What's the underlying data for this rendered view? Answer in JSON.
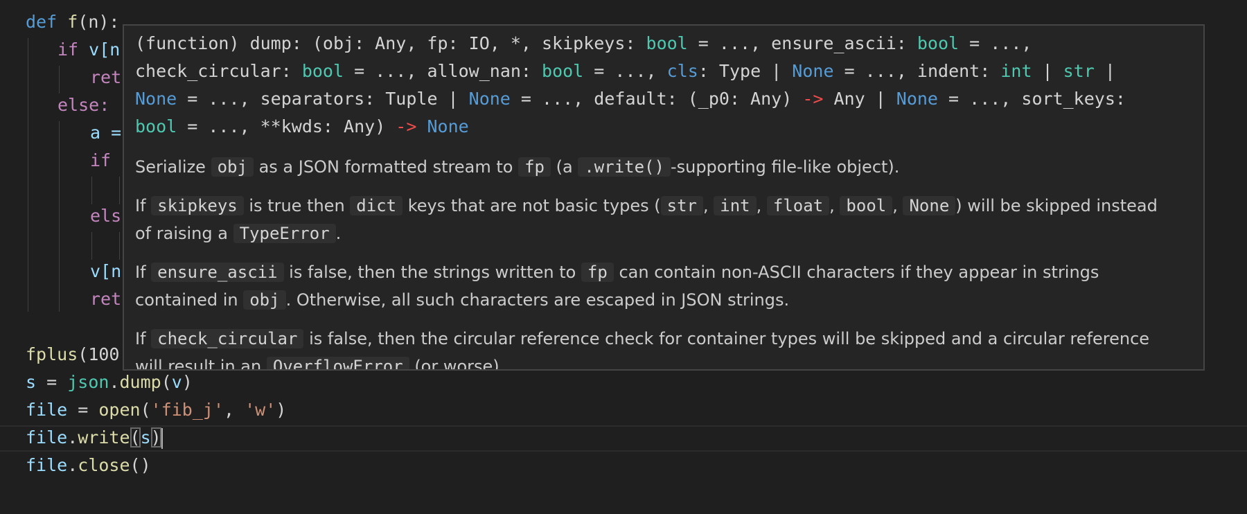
{
  "editor": {
    "lines": {
      "l1": {
        "kw": "def",
        "name": "f",
        "rest": "(n):"
      },
      "l2": {
        "kw": "if",
        "rest": " v[n"
      },
      "l3": {
        "text": "ret"
      },
      "l4": {
        "text": "else:"
      },
      "l5": {
        "text": "a ="
      },
      "l6": {
        "text": "if"
      },
      "l7": {
        "text": "els"
      },
      "l8": {
        "text": "v[n"
      },
      "l9": {
        "text": "ret"
      },
      "l10": {
        "name": "fplus",
        "rest": "(100"
      },
      "l11": {
        "var": "s",
        "eq": " = ",
        "mod": "json",
        "dot": ".",
        "fn": "dump",
        "open": "(",
        "arg": "v",
        "close": ")"
      },
      "l12": {
        "var": "file",
        "eq": " = ",
        "fn": "open",
        "open": "(",
        "s1": "'fib_j'",
        "comma": ", ",
        "s2": "'w'",
        "close": ")"
      },
      "l13": {
        "var": "file",
        "dot": ".",
        "fn": "write",
        "open": "(",
        "arg": "s",
        "close": ")"
      },
      "l14": {
        "var": "file",
        "dot": ".",
        "fn": "close",
        "paren": "()"
      }
    }
  },
  "hover": {
    "signature": {
      "s1": "(function) dump: (obj: Any, fp: IO, *, skipkeys: ",
      "t1": "bool",
      "s2": " = ..., ensure_ascii: ",
      "t2": "bool",
      "s3": " = ...,",
      "s4": "check_circular: ",
      "t3": "bool",
      "s5": " = ..., allow_nan: ",
      "t4": "bool",
      "s6": " = ..., ",
      "p1": "cls",
      "s7": ": Type | ",
      "n1": "None",
      "s8": " = ..., indent: ",
      "t5": "int",
      "s9": " | ",
      "t6": "str",
      "s10": " |",
      "n2": "None",
      "s11": " = ..., separators: Tuple | ",
      "n3": "None",
      "s12": " = ..., default: (_p0: Any) ",
      "a1": "->",
      "s13": " Any | ",
      "n4": "None",
      "s14": " = ..., sort_keys:",
      "t7": "bool",
      "s15": " = ..., **kwds: Any) ",
      "a2": "->",
      "s16": " ",
      "n5": "None"
    },
    "p1": {
      "a": "Serialize ",
      "c1": "obj",
      "b": " as a JSON formatted stream to ",
      "c2": "fp",
      "d": " (a ",
      "c3": ".write()",
      "e": "-supporting file-like object)."
    },
    "p2": {
      "a": "If ",
      "c1": "skipkeys",
      "b": " is true then ",
      "c2": "dict",
      "d": " keys that are not basic types (",
      "c3": "str",
      "e": ", ",
      "c4": "int",
      "f": ", ",
      "c5": "float",
      "g": ", ",
      "c6": "bool",
      "h": ", ",
      "c7": "None",
      "i": ") will be skipped instead",
      "j": "of raising a ",
      "c8": "TypeError",
      "k": "."
    },
    "p3": {
      "a": "If ",
      "c1": "ensure_ascii",
      "b": " is false, then the strings written to ",
      "c2": "fp",
      "d": " can contain non-ASCII characters if they appear in strings",
      "e": "contained in ",
      "c3": "obj",
      "f": ". Otherwise, all such characters are escaped in JSON strings."
    },
    "p4": {
      "a": "If ",
      "c1": "check_circular",
      "b": " is false, then the circular reference check for container types will be skipped and a circular reference",
      "c": "will result in an ",
      "c2": "OverflowError",
      "d": " (or worse)."
    }
  }
}
